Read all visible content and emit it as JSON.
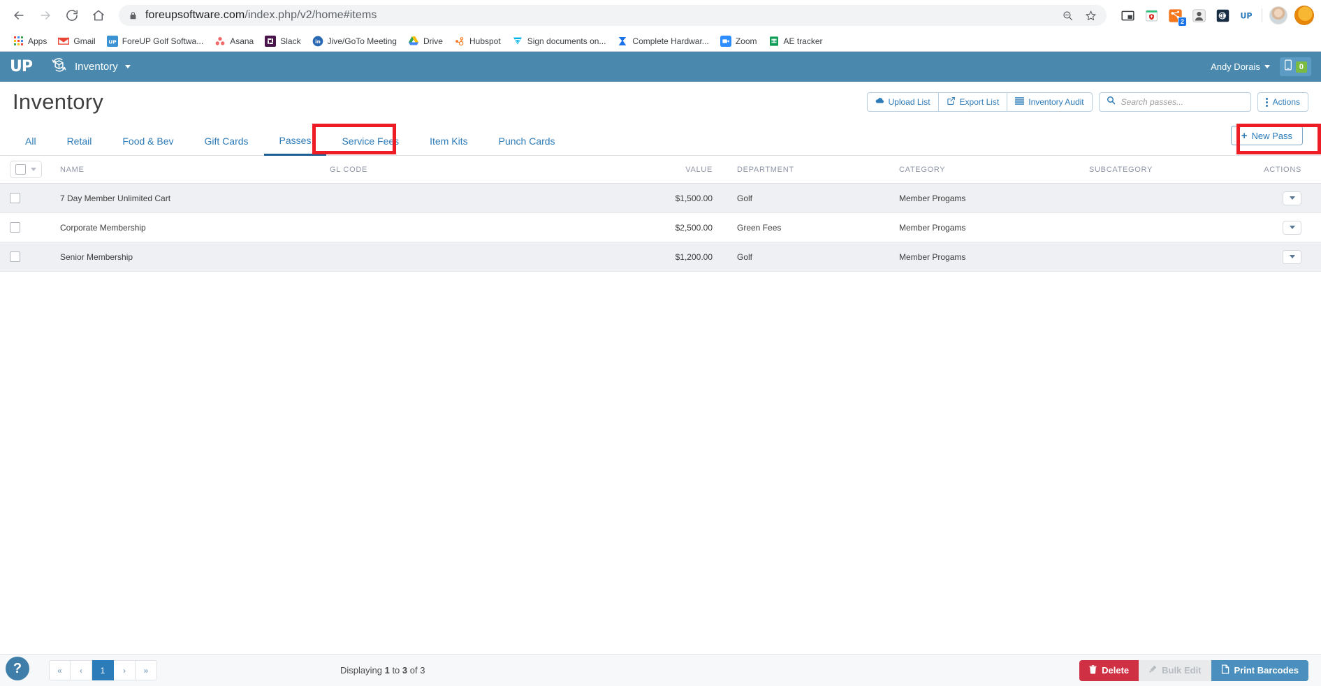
{
  "browser": {
    "url_prefix": "foreupsoftware.com",
    "url_path": "/index.php/v2/home#items",
    "back_icon": "back-arrow-icon",
    "forward_icon": "forward-arrow-icon",
    "reload_icon": "reload-icon",
    "home_icon": "home-icon",
    "lock_icon": "lock-icon",
    "zoom_out_icon": "zoom-out-icon",
    "bookmark_star_icon": "star-icon",
    "extensions": [
      {
        "name": "picture-in-picture-icon",
        "badge": ""
      },
      {
        "name": "calendar-shield-icon",
        "badge": ""
      },
      {
        "name": "hubspot-sales-icon",
        "badge": "2"
      },
      {
        "name": "portrait-extension-icon",
        "badge": ""
      },
      {
        "name": "dark-reader-icon",
        "badge": ""
      },
      {
        "name": "foreup-extension-icon",
        "badge": ""
      }
    ],
    "bookmarks": [
      {
        "label": "Apps",
        "icon": "apps-grid-icon"
      },
      {
        "label": "Gmail",
        "icon": "gmail-icon"
      },
      {
        "label": "ForeUP Golf Softwa...",
        "icon": "foreup-icon"
      },
      {
        "label": "Asana",
        "icon": "asana-icon"
      },
      {
        "label": "Slack",
        "icon": "slack-icon"
      },
      {
        "label": "Jive/GoTo Meeting",
        "icon": "jive-icon"
      },
      {
        "label": "Drive",
        "icon": "google-drive-icon"
      },
      {
        "label": "Hubspot",
        "icon": "hubspot-icon"
      },
      {
        "label": "Sign documents on...",
        "icon": "hellosign-icon"
      },
      {
        "label": "Complete Hardwar...",
        "icon": "hardware-icon"
      },
      {
        "label": "Zoom",
        "icon": "zoom-app-icon"
      },
      {
        "label": "AE tracker",
        "icon": "sheets-icon"
      }
    ]
  },
  "app_header": {
    "logo": "UP",
    "module_icon": "inventory-box-icon",
    "module_label": "Inventory",
    "user_name": "Andy Dorais",
    "messages_icon": "mobile-phone-icon",
    "messages_count": "0",
    "bar_color": "#4a89ad",
    "badge_color": "#7cbb42"
  },
  "page": {
    "title": "Inventory",
    "toolbar": {
      "upload_label": "Upload List",
      "upload_icon": "cloud-upload-icon",
      "export_label": "Export List",
      "export_icon": "export-share-icon",
      "audit_label": "Inventory Audit",
      "audit_icon": "list-lines-icon",
      "search_placeholder": "Search passes...",
      "search_value": "",
      "search_icon": "search-icon",
      "actions_label": "Actions",
      "actions_icon": "vertical-dots-icon"
    },
    "tabs": [
      {
        "label": "All",
        "active": false
      },
      {
        "label": "Retail",
        "active": false
      },
      {
        "label": "Food & Bev",
        "active": false
      },
      {
        "label": "Gift Cards",
        "active": false
      },
      {
        "label": "Passes",
        "active": true
      },
      {
        "label": "Service Fees",
        "active": false
      },
      {
        "label": "Item Kits",
        "active": false
      },
      {
        "label": "Punch Cards",
        "active": false
      }
    ],
    "new_button": {
      "label": "New Pass",
      "plus": "+"
    },
    "highlight_color": "#ee1c25"
  },
  "table": {
    "columns": [
      "NAME",
      "GL CODE",
      "VALUE",
      "DEPARTMENT",
      "CATEGORY",
      "SUBCATEGORY",
      "ACTIONS"
    ],
    "rows": [
      {
        "name": "7 Day Member Unlimited Cart",
        "gl_code": "",
        "value": "$1,500.00",
        "department": "Golf",
        "category": "Member Progams",
        "subcategory": "",
        "checked": false
      },
      {
        "name": "Corporate Membership",
        "gl_code": "",
        "value": "$2,500.00",
        "department": "Green Fees",
        "category": "Member Progams",
        "subcategory": "",
        "checked": false
      },
      {
        "name": "Senior Membership",
        "gl_code": "",
        "value": "$1,200.00",
        "department": "Golf",
        "category": "Member Progams",
        "subcategory": "",
        "checked": false
      }
    ]
  },
  "footer": {
    "help_label": "?",
    "pager": [
      {
        "label": "«",
        "current": false
      },
      {
        "label": "‹",
        "current": false
      },
      {
        "label": "1",
        "current": true
      },
      {
        "label": "›",
        "current": false
      },
      {
        "label": "»",
        "current": false
      }
    ],
    "displaying_prefix": "Displaying ",
    "displaying_from": "1",
    "displaying_mid": " to ",
    "displaying_to": "3",
    "displaying_suffix": " of 3",
    "delete_label": "Delete",
    "delete_icon": "trash-icon",
    "bulk_edit_label": "Bulk Edit",
    "bulk_edit_icon": "pencil-icon",
    "print_label": "Print Barcodes",
    "print_icon": "document-icon"
  }
}
